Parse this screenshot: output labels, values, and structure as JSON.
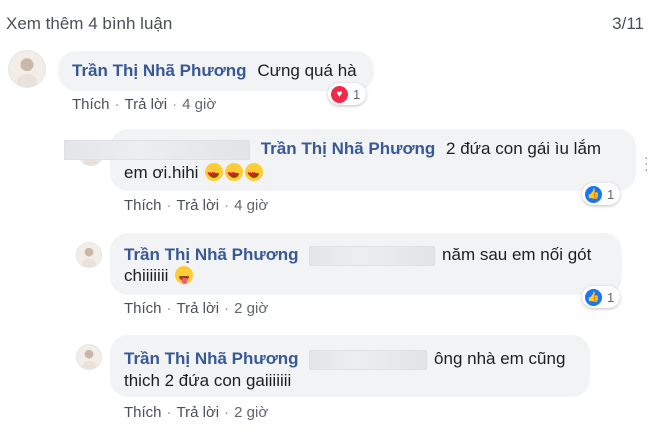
{
  "header": {
    "see_more": "Xem thêm 4 bình luận",
    "counter": "3/11"
  },
  "actions": {
    "like": "Thích",
    "reply": "Trả lời",
    "separator": "·"
  },
  "comments": [
    {
      "author": "Trần Thị Nhã Phương",
      "text": "Cưng quá hà",
      "time": "4 giờ",
      "reaction": {
        "icon": "heart-icon",
        "count": "1"
      }
    },
    {
      "author": "",
      "mention": "Trần Thị Nhã Phương",
      "line1": "2 đứa con gái ìu lắm",
      "line2": "em ơi.hihi",
      "emojis": [
        "heart-eyes-emoji",
        "heart-eyes-emoji",
        "heart-eyes-emoji"
      ],
      "time": "4 giờ",
      "reaction": {
        "icon": "like-icon",
        "count": "1"
      }
    },
    {
      "author": "Trần Thị Nhã Phương",
      "line1": "năm sau em nối gót",
      "line2": "chiiiiiii",
      "emoji": "tongue-emoji",
      "time": "2 giờ",
      "reaction": {
        "icon": "like-icon",
        "count": "1"
      }
    },
    {
      "author": "Trần Thị Nhã Phương",
      "line1": "ông nhà em cũng",
      "line2": "thich 2 đứa con gaiiiiiii",
      "time": "2 giờ"
    }
  ],
  "colors": {
    "name": "#385898",
    "bubble": "#f2f3f5",
    "like": "#1877f2",
    "love": "#f0284a"
  }
}
